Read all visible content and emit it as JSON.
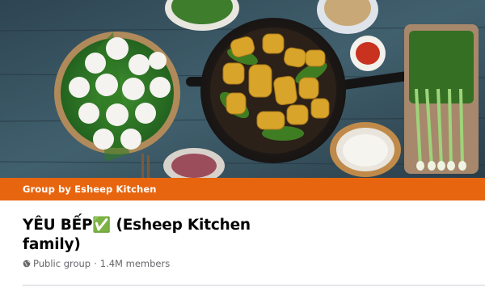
{
  "group": {
    "owner_label": "Group by Esheep Kitchen",
    "title": "YÊU BẾP✅ (Esheep Kitchen family)",
    "privacy": "Public group",
    "separator": "·",
    "members": "1.4M members",
    "privacy_icon": "globe-icon"
  },
  "colors": {
    "owner_bar": "#e8650f",
    "cover_table": "#3a5361"
  }
}
